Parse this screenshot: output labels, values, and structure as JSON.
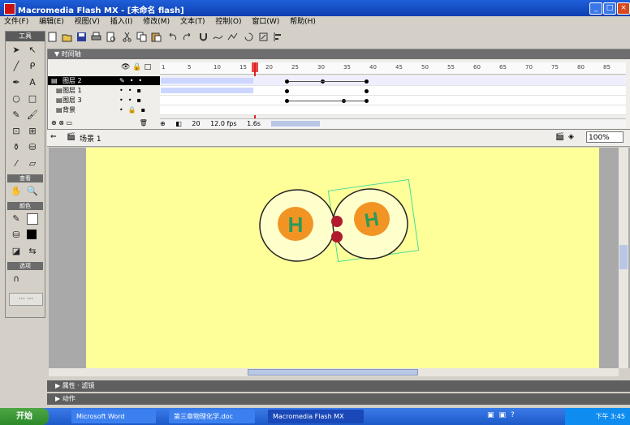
{
  "window": {
    "title": "Macromedia Flash MX - [未命名 flash]"
  },
  "menu": [
    "文件(F)",
    "编辑(E)",
    "视图(V)",
    "插入(I)",
    "修改(M)",
    "文本(T)",
    "控制(O)",
    "窗口(W)",
    "帮助(H)"
  ],
  "tools": {
    "header": "工具",
    "view_label": "查看",
    "colors_label": "颜色",
    "options_label": "选项"
  },
  "timeline": {
    "header": "▼ 时间轴",
    "layers": [
      "图层 2",
      "图层 1",
      "图层 3",
      "背景"
    ],
    "ruler_ticks": [
      "1",
      "5",
      "10",
      "15",
      "20",
      "25",
      "30",
      "35",
      "40",
      "45",
      "50",
      "55",
      "60",
      "65",
      "70",
      "75",
      "80",
      "85"
    ],
    "status": {
      "frame": "20",
      "fps": "12.0 fps",
      "time": "1.6s"
    }
  },
  "scene": {
    "label": "场景 1",
    "zoom": "100%"
  },
  "panels": [
    "▶ 属性 · 滤镜",
    "▶ 动作"
  ],
  "taskbar": {
    "start": "开始",
    "tasks": [
      "Microsoft Word",
      "第三章物理化学.doc",
      "Macromedia Flash MX"
    ],
    "clock": "下午 3:45"
  },
  "stage": {
    "atom_label": "H",
    "background_color": "#ffff99"
  }
}
